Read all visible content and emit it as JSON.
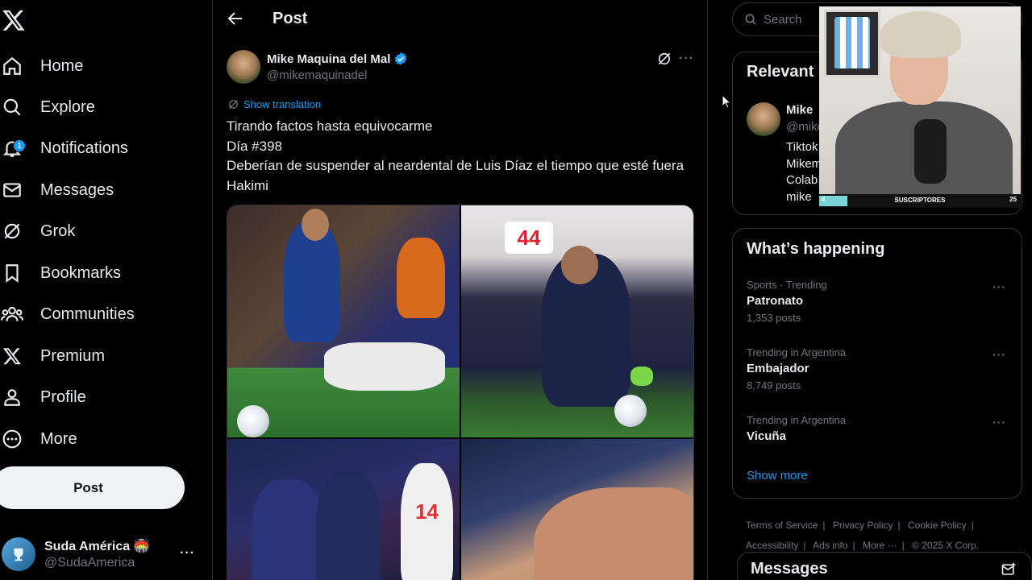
{
  "nav": {
    "items": [
      {
        "label": "Home",
        "icon": "home-icon"
      },
      {
        "label": "Explore",
        "icon": "search-icon"
      },
      {
        "label": "Notifications",
        "icon": "bell-icon",
        "badge": "1"
      },
      {
        "label": "Messages",
        "icon": "envelope-icon"
      },
      {
        "label": "Grok",
        "icon": "grok-icon"
      },
      {
        "label": "Bookmarks",
        "icon": "bookmark-icon"
      },
      {
        "label": "Communities",
        "icon": "communities-icon"
      },
      {
        "label": "Premium",
        "icon": "x-logo-icon"
      },
      {
        "label": "Profile",
        "icon": "person-icon"
      },
      {
        "label": "More",
        "icon": "more-circle-icon"
      }
    ],
    "post_button": "Post",
    "account": {
      "name": "Suda América 🏟️",
      "handle": "@SudaAmerica"
    }
  },
  "main": {
    "header_title": "Post",
    "author": {
      "name": "Mike Maquina del Mal",
      "handle": "@mikemaquinadel"
    },
    "show_translation": "Show translation",
    "text_lines": [
      "Tirando factos hasta equivocarme",
      "Día #398",
      "Deberían de suspender al neardental de Luis Díaz el tiempo que esté fuera Hakimi"
    ]
  },
  "right": {
    "search_placeholder": "Search",
    "relevant": {
      "title": "Relevant",
      "name": "Mike",
      "handle": "@mike",
      "bio_lines": [
        "Tiktok",
        "Mikem",
        "Colab",
        "mike"
      ]
    },
    "whats_happening": {
      "title": "What’s happening",
      "trends": [
        {
          "context": "Sports · Trending",
          "name": "Patronato",
          "count": "1,353 posts"
        },
        {
          "context": "Trending in Argentina",
          "name": "Embajador",
          "count": "8,749 posts"
        },
        {
          "context": "Trending in Argentina",
          "name": "Vicuña",
          "count": ""
        }
      ],
      "show_more": "Show more"
    },
    "footer": [
      "Terms of Service",
      "Privacy Policy",
      "Cookie Policy",
      "Accessibility",
      "Ads info",
      "More ···",
      "© 2025 X Corp."
    ],
    "messages_title": "Messages"
  },
  "webcam": {
    "bar_left": "4",
    "bar_label": "SUSCRIPTORES",
    "bar_right": "25"
  },
  "colors": {
    "accent": "#1d9bf0",
    "bg": "#000000",
    "border": "#2f3336",
    "muted": "#71767b"
  }
}
